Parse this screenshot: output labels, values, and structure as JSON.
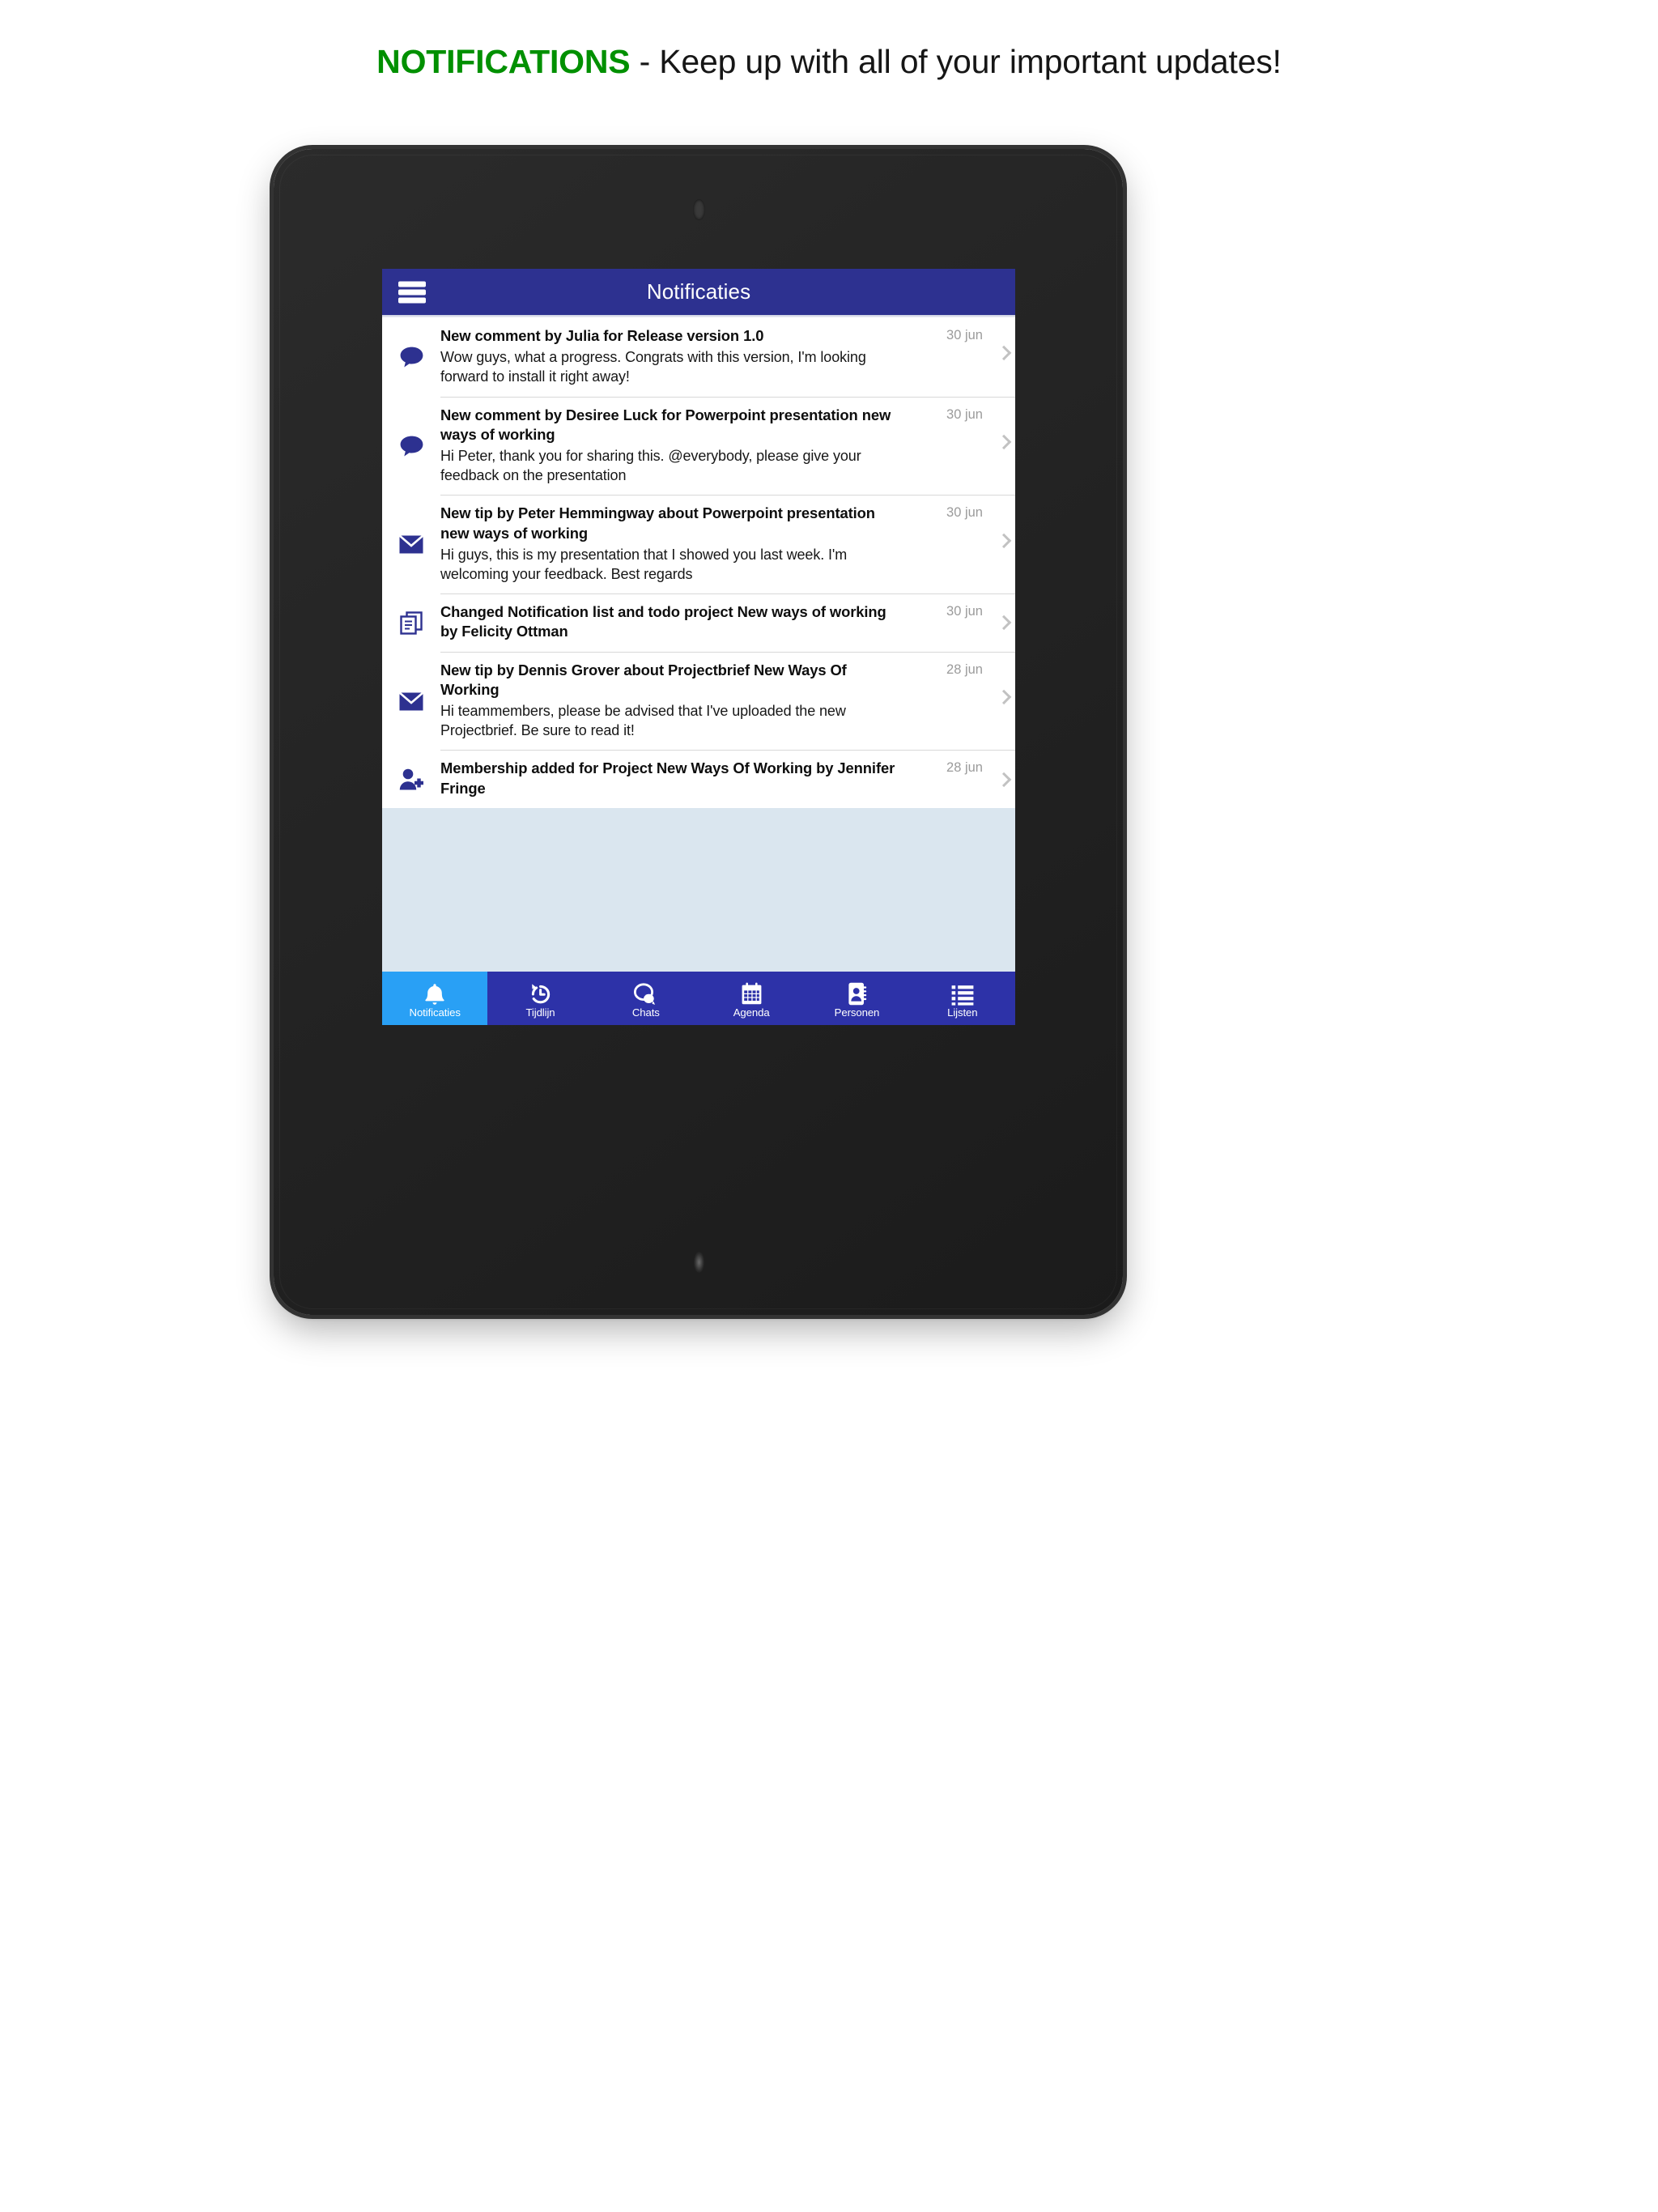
{
  "caption": {
    "keyword": "NOTIFICATIONS",
    "rest": " - Keep up with all of your important updates!"
  },
  "colors": {
    "appbar": "#2D3190",
    "bottomnav": "#2D32A8",
    "active_tab": "#29A0F5",
    "icon_blue": "#2D3190",
    "empty_area": "#DAE6EF",
    "caption_keyword": "#009000"
  },
  "appbar": {
    "menu_icon": "hamburger-menu-icon",
    "title": "Notificaties"
  },
  "notifications": [
    {
      "icon": "chat-bubble-icon",
      "title": "New comment by Julia for Release version 1.0",
      "body": "Wow guys, what a progress. Congrats with this version, I'm looking forward to install it right away!",
      "date": "30 jun"
    },
    {
      "icon": "chat-bubble-icon",
      "title": "New comment by Desiree Luck for Powerpoint presentation new ways of working",
      "body": "Hi Peter, thank you for sharing this. @everybody, please give your feedback on the presentation",
      "date": "30 jun"
    },
    {
      "icon": "envelope-icon",
      "title": "New tip by Peter Hemmingway about Powerpoint presentation new ways of working",
      "body": "Hi guys, this is my presentation that I showed you last week. I'm welcoming your feedback. Best regards",
      "date": "30 jun"
    },
    {
      "icon": "documents-copy-icon",
      "title": "Changed Notification list and todo project New ways of working by Felicity Ottman",
      "body": "",
      "date": "30 jun"
    },
    {
      "icon": "envelope-icon",
      "title": "New tip by Dennis Grover about Projectbrief New Ways Of Working",
      "body": "Hi teammembers, please be advised that I've uploaded the new Projectbrief. Be sure to read it!",
      "date": "28 jun"
    },
    {
      "icon": "person-add-icon",
      "title": "Membership added for Project New Ways Of Working by Jennifer Fringe",
      "body": "",
      "date": "28 jun"
    }
  ],
  "bottom_nav": [
    {
      "icon": "bell-icon",
      "label": "Notificaties",
      "active": true
    },
    {
      "icon": "history-clock-icon",
      "label": "Tijdlijn",
      "active": false
    },
    {
      "icon": "chat-bubbles-icon",
      "label": "Chats",
      "active": false
    },
    {
      "icon": "calendar-icon",
      "label": "Agenda",
      "active": false
    },
    {
      "icon": "contact-book-icon",
      "label": "Personen",
      "active": false
    },
    {
      "icon": "list-icon",
      "label": "Lijsten",
      "active": false
    }
  ]
}
